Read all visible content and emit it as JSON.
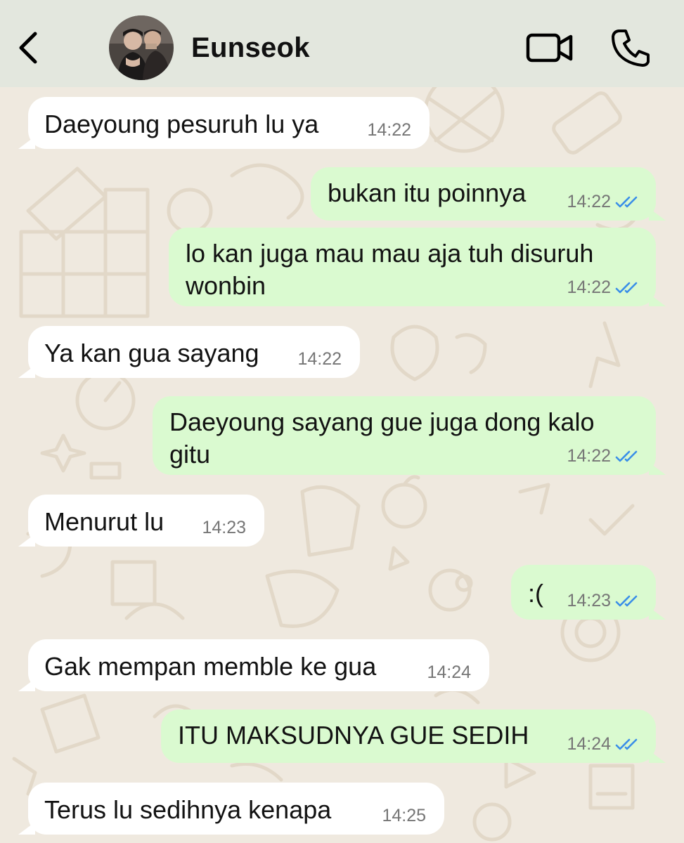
{
  "header": {
    "contact_name": "Eunseok",
    "back_icon": "chevron-left-icon",
    "video_icon": "video-camera-icon",
    "call_icon": "phone-icon",
    "background": "#e3e7de"
  },
  "colors": {
    "incoming_bubble": "#ffffff",
    "outgoing_bubble": "#dafad0",
    "read_ticks": "#3a8ee8",
    "wallpaper": "#efe9df"
  },
  "messages": [
    {
      "direction": "incoming",
      "text": "Daeyoung pesuruh lu ya",
      "time": "14:22"
    },
    {
      "direction": "outgoing",
      "text": "bukan itu poinnya",
      "time": "14:22",
      "status": "read"
    },
    {
      "direction": "outgoing",
      "text": "lo kan juga mau mau aja tuh disuruh wonbin",
      "time": "14:22",
      "status": "read"
    },
    {
      "direction": "incoming",
      "text": "Ya kan gua sayang",
      "time": "14:22"
    },
    {
      "direction": "outgoing",
      "text": "Daeyoung sayang gue juga dong kalo gitu",
      "time": "14:22",
      "status": "read"
    },
    {
      "direction": "incoming",
      "text": "Menurut lu",
      "time": "14:23"
    },
    {
      "direction": "outgoing",
      "text": ":(",
      "time": "14:23",
      "status": "read"
    },
    {
      "direction": "incoming",
      "text": "Gak mempan memble ke gua",
      "time": "14:24"
    },
    {
      "direction": "outgoing",
      "text": "ITU MAKSUDNYA GUE SEDIH",
      "time": "14:24",
      "status": "read"
    },
    {
      "direction": "incoming",
      "text": "Terus lu sedihnya kenapa",
      "time": "14:25"
    }
  ]
}
